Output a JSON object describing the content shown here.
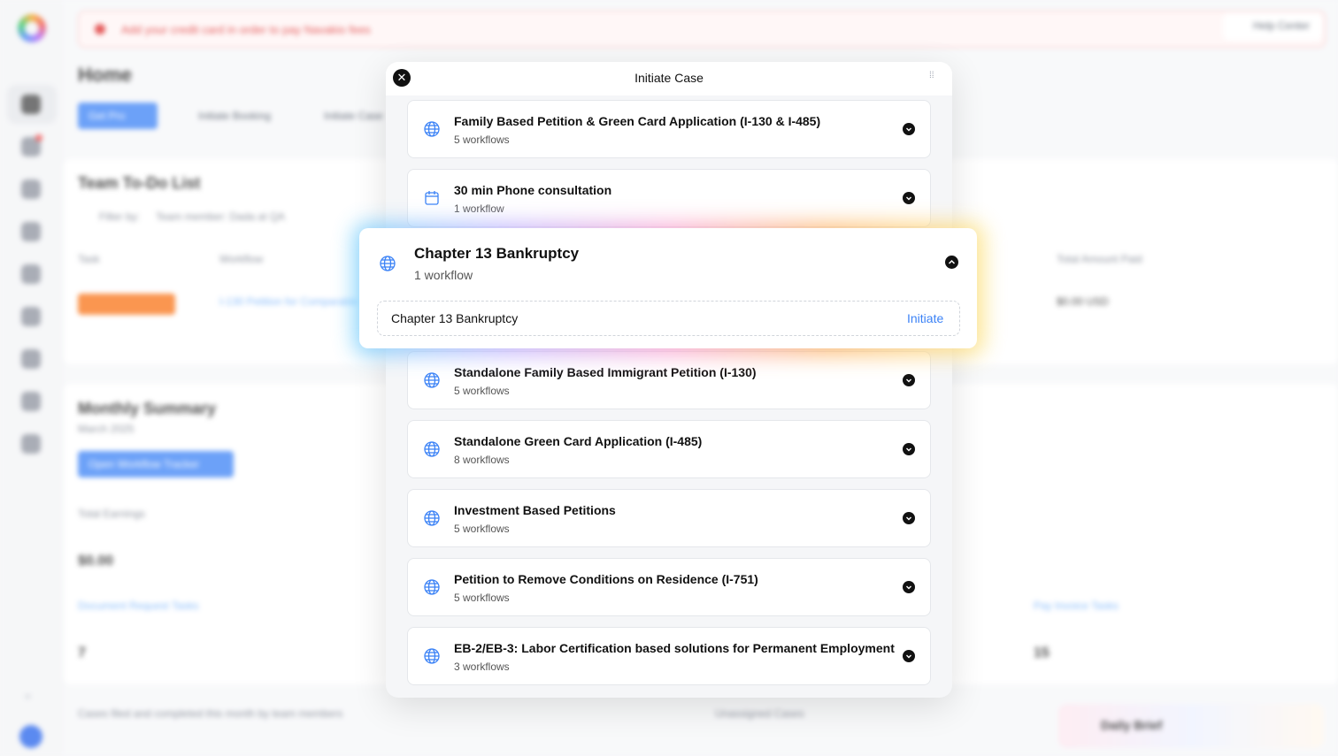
{
  "background": {
    "banner_text": "Add your credit card in order to pay Navakio fees",
    "help_label": "Help Center",
    "page_title": "Home",
    "new_button": "Get Pro",
    "initiate_booking": "Initiate Booking",
    "initiate_case": "Initiate Case",
    "todo_title": "Team To-Do List",
    "filter_label": "Filter by:",
    "filter_value": "Team member: Dada at QA",
    "col_task": "Task",
    "col_workflow": "Workflow",
    "col_total": "Total Amount Paid",
    "row_workflow": "I-130 Petition for Comparable",
    "row_total": "$0.00 USD",
    "monthly_title": "Monthly Summary",
    "monthly_month": "March 2025",
    "monthly_button": "Open Workflow Tracker",
    "total_earnings_label": "Total Earnings",
    "total_earnings_value": "$0.00",
    "doc_request_link": "Document Request Tasks",
    "doc_request_value": "7",
    "file_invoice_link": "Pay Invoice Tasks",
    "file_invoice_value": "15",
    "cases_label": "Cases filed and completed this month by team members",
    "unassigned_label": "Unassigned Cases",
    "daily_brief": "Daily Brief"
  },
  "modal": {
    "title": "Initiate Case",
    "cases": [
      {
        "title": "Family Based Petition & Green Card Application (I-130 & I-485)",
        "subtitle": "5 workflows",
        "icon": "globe-icon"
      },
      {
        "title": "30 min Phone consultation",
        "subtitle": "1 workflow",
        "icon": "calendar-icon"
      },
      {
        "title": "Standalone Family Based Immigrant Petition (I-130)",
        "subtitle": "5 workflows",
        "icon": "globe-icon"
      },
      {
        "title": "Standalone Green Card Application (I-485)",
        "subtitle": "8 workflows",
        "icon": "globe-icon"
      },
      {
        "title": "Investment Based Petitions",
        "subtitle": "5 workflows",
        "icon": "globe-icon"
      },
      {
        "title": "Petition to Remove Conditions on Residence (I-751)",
        "subtitle": "5 workflows",
        "icon": "globe-icon"
      },
      {
        "title": "EB-2/EB-3: Labor Certification based solutions for Permanent Employment",
        "subtitle": "3 workflows",
        "icon": "globe-icon"
      }
    ],
    "expanded": {
      "title": "Chapter 13 Bankruptcy",
      "subtitle": "1 workflow",
      "workflow_name": "Chapter 13 Bankruptcy",
      "action_label": "Initiate",
      "icon": "globe-icon"
    }
  },
  "colors": {
    "accent": "#3b82f6",
    "text": "#111111",
    "muted": "#555555"
  }
}
